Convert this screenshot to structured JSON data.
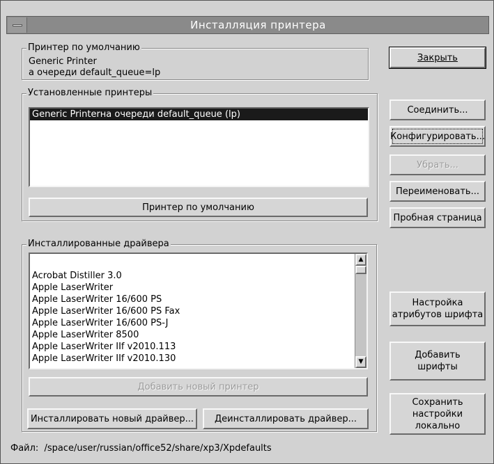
{
  "window": {
    "title": "Инсталляция принтера"
  },
  "default_printer": {
    "legend": "Принтер по умолчанию",
    "line1": "Generic Printer",
    "line2": "а очереди default_queue=lp"
  },
  "installed_printers": {
    "legend": "Установленные принтеры",
    "items": [
      "Generic Printerна очереди default_queue (lp)"
    ],
    "default_button": "Принтер по умолчанию"
  },
  "drivers": {
    "legend": "Инсталлированные драйвера",
    "items": [
      "",
      "Acrobat Distiller 3.0",
      "Apple LaserWriter",
      "Apple LaserWriter 16/600 PS",
      "Apple LaserWriter 16/600 PS Fax",
      "Apple LaserWriter 16/600 PS-J",
      "Apple LaserWriter 8500",
      "Apple LaserWriter IIf v2010.113",
      "Apple LaserWriter IIf v2010.130"
    ]
  },
  "buttons": {
    "close": "Закрыть",
    "connect": "Соединить...",
    "configure": "Конфигурировать...",
    "remove": "Убрать...",
    "rename": "Переименовать...",
    "test_page": "Пробная страница",
    "font_attributes": "Настройка\nатрибутов шрифта",
    "add_fonts": "Добавить\nшрифты",
    "save_locally": "Сохранить настройки\nлокально",
    "add_printer": "Добавить новый принтер",
    "install_driver": "Инсталлировать новый драйвер...",
    "uninstall_driver": "Деинсталлировать драйвер..."
  },
  "footer": {
    "file_label": "Файл:",
    "file_path": "/space/user/russian/office52/share/xp3/Xpdefaults"
  }
}
